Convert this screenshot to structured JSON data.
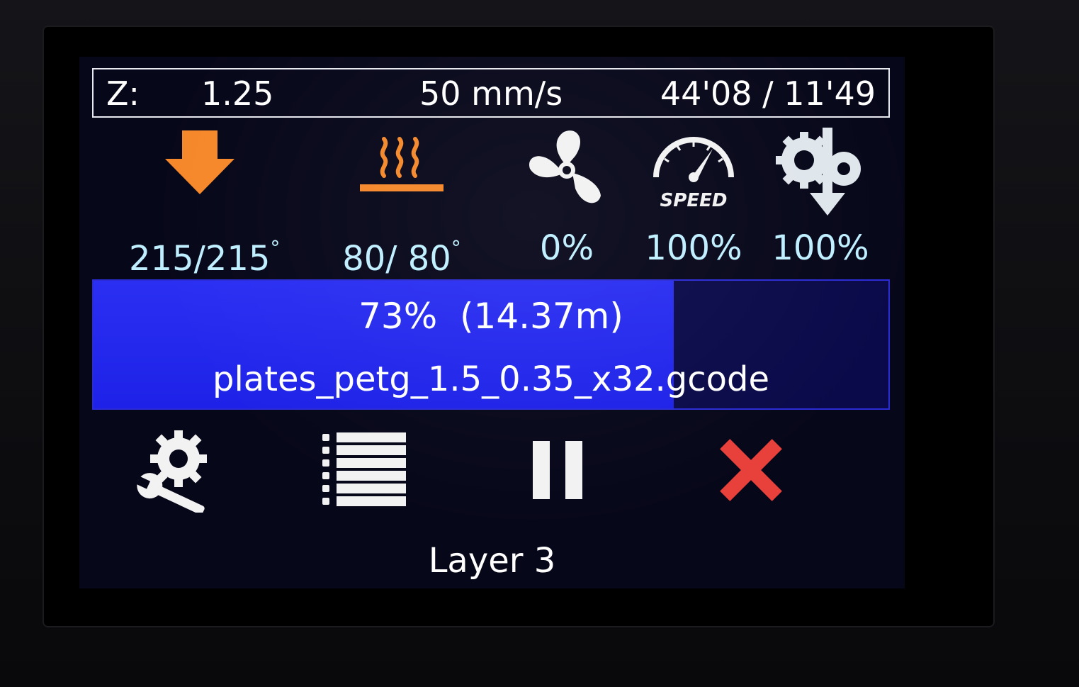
{
  "status": {
    "z_label": "Z:",
    "z_value": "1.25",
    "speed": "50 mm/s",
    "time": "44'08 / 11'49"
  },
  "stats": {
    "nozzle": {
      "icon": "nozzle-arrow-icon",
      "value": "215/215",
      "unit": "°"
    },
    "bed": {
      "icon": "heated-bed-icon",
      "value": "80/ 80",
      "unit": "°"
    },
    "fan": {
      "icon": "fan-icon",
      "value": "0%"
    },
    "speed": {
      "icon": "speed-gauge-icon",
      "label": "SPEED",
      "value": "100%"
    },
    "flow": {
      "icon": "extruder-flow-icon",
      "value": "100%"
    }
  },
  "progress": {
    "percent": 73,
    "text": "73%  (14.37m)",
    "filename": "plates_petg_1.5_0.35_x32.gcode"
  },
  "buttons": {
    "settings": "settings-wrench-icon",
    "menu": "list-menu-icon",
    "pause": "pause-icon",
    "stop": "stop-x-icon"
  },
  "layer": "Layer 3",
  "colors": {
    "accent_orange": "#f5882a",
    "value_cyan": "#bfefff",
    "progress_fill": "#2227ee",
    "progress_bg": "#0a0a4a",
    "stop_red": "#e8403a"
  }
}
